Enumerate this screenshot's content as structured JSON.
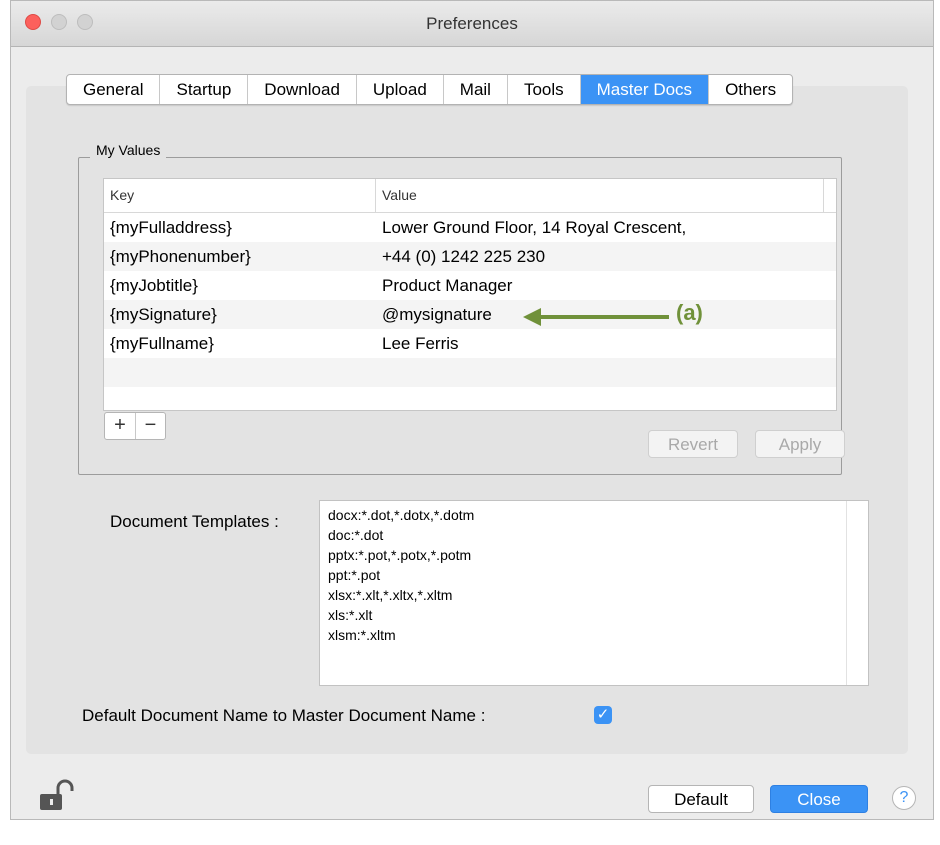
{
  "window": {
    "title": "Preferences"
  },
  "tabs": [
    {
      "label": "General"
    },
    {
      "label": "Startup"
    },
    {
      "label": "Download"
    },
    {
      "label": "Upload"
    },
    {
      "label": "Mail"
    },
    {
      "label": "Tools"
    },
    {
      "label": "Master Docs",
      "active": true
    },
    {
      "label": "Others"
    }
  ],
  "my_values": {
    "group_label": "My Values",
    "columns": {
      "key": "Key",
      "value": "Value"
    },
    "rows": [
      {
        "key": "{myFulladdress}",
        "value": "Lower Ground Floor, 14 Royal Crescent,"
      },
      {
        "key": "{myPhonenumber}",
        "value": "+44 (0) 1242 225 230"
      },
      {
        "key": "{myJobtitle}",
        "value": "Product Manager"
      },
      {
        "key": "{mySignature}",
        "value": "@mysignature"
      },
      {
        "key": "{myFullname}",
        "value": "Lee Ferris"
      }
    ],
    "add_label": "+",
    "remove_label": "−",
    "revert_label": "Revert",
    "apply_label": "Apply"
  },
  "annotation": {
    "label": "(a)",
    "color": "#70913a"
  },
  "document_templates": {
    "label": "Document Templates :",
    "lines": [
      "docx:*.dot,*.dotx,*.dotm",
      "doc:*.dot",
      "pptx:*.pot,*.potx,*.potm",
      "ppt:*.pot",
      "xlsx:*.xlt,*.xltx,*.xltm",
      "xls:*.xlt",
      "xlsm:*.xltm"
    ]
  },
  "default_name": {
    "label": "Default Document Name to Master Document Name :",
    "checked": true
  },
  "footer": {
    "default_label": "Default",
    "close_label": "Close",
    "help_label": "?"
  },
  "colors": {
    "accent": "#3b93f5",
    "traffic_close": "#fc605c"
  },
  "icons": {
    "lock": "unlock-icon",
    "help": "help-icon",
    "check": "checkmark-icon"
  }
}
